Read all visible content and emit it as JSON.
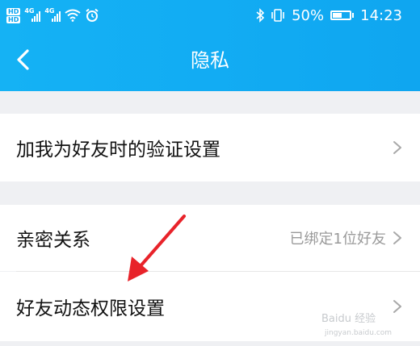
{
  "status_bar": {
    "hd1": "HD",
    "hd2": "HD",
    "net1": "4G",
    "net2": "4G",
    "battery": "50%",
    "time": "14:23"
  },
  "navbar": {
    "title": "隐私"
  },
  "section1": {
    "items": [
      {
        "label": "加我为好友时的验证设置",
        "value": ""
      }
    ]
  },
  "section2": {
    "items": [
      {
        "label": "亲密关系",
        "value": "已绑定1位好友"
      },
      {
        "label": "好友动态权限设置",
        "value": ""
      }
    ]
  },
  "watermark": {
    "text": "Baidu 经验",
    "sub": "jingyan.baidu.com"
  },
  "colors": {
    "header": "#12acf3",
    "background": "#eff0f3",
    "annotation_arrow": "#e8232a"
  }
}
